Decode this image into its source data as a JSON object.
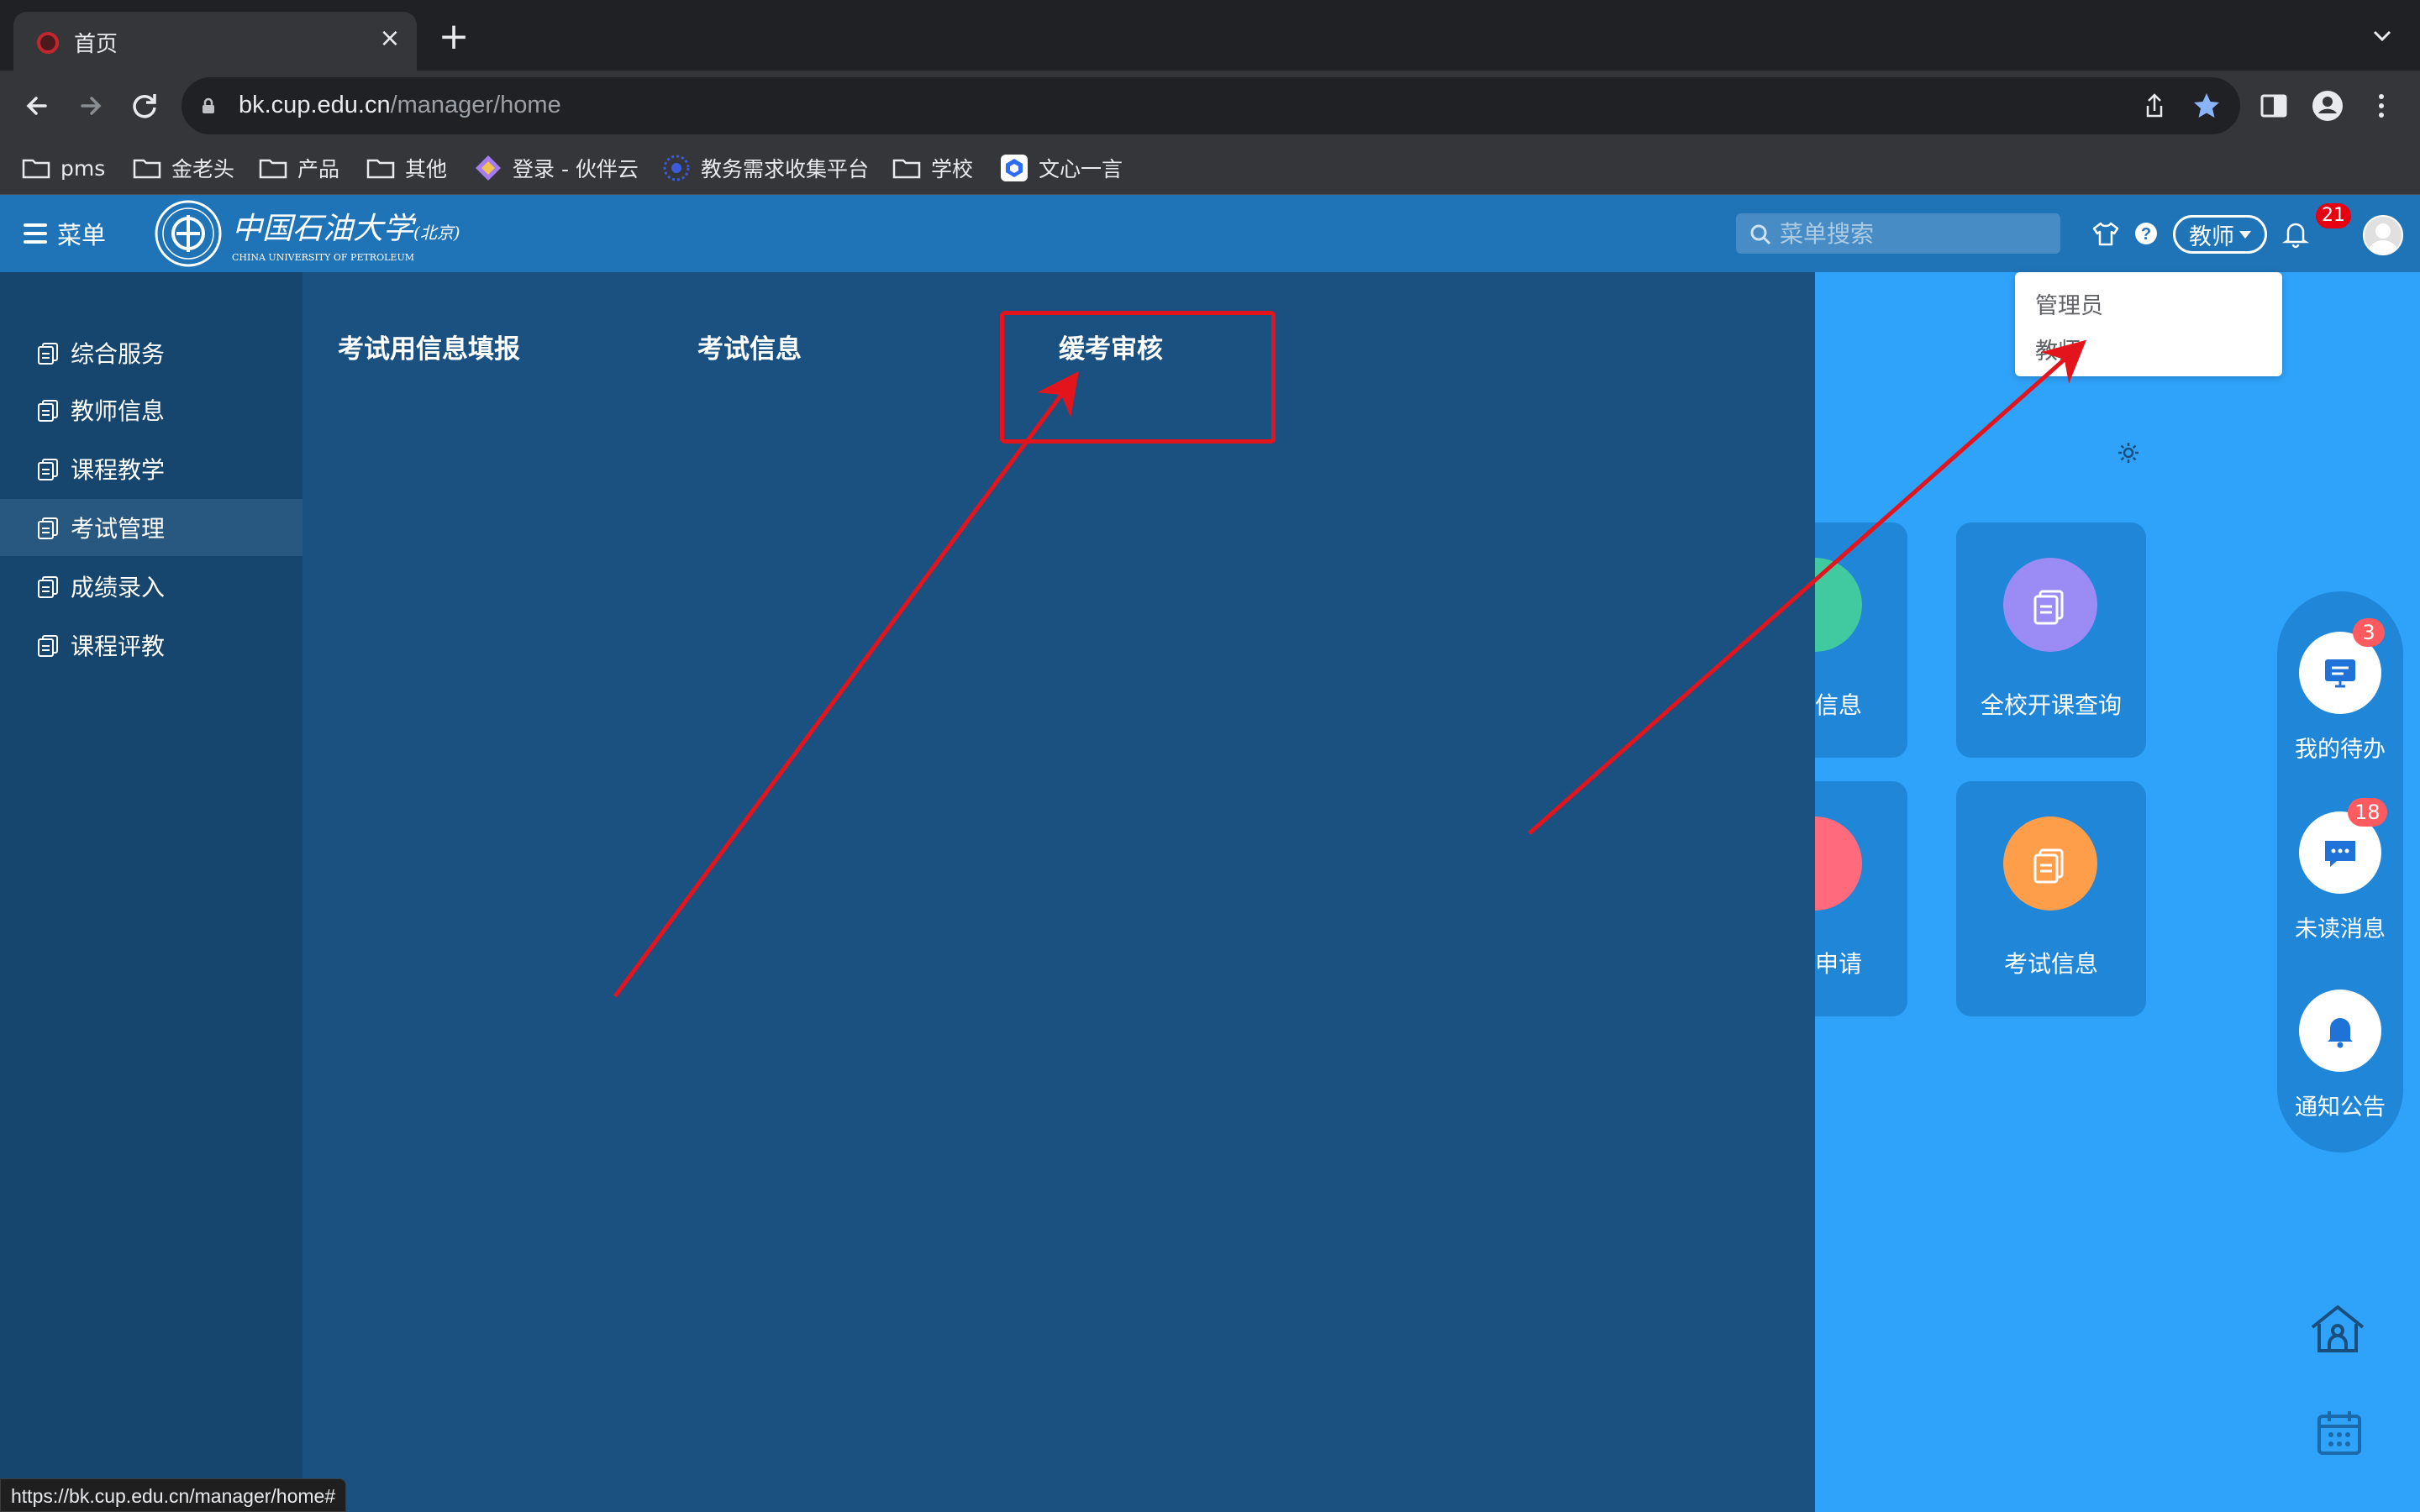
{
  "browser": {
    "tab_title": "首页",
    "tab_close": "×",
    "new_tab": "+",
    "url_host": "bk.cup.edu.cn",
    "url_path": "/manager/home",
    "bookmarks": [
      "pms",
      "金老头",
      "产品",
      "其他",
      "登录 - 伙伴云",
      "教务需求收集平台",
      "学校",
      "文心一言"
    ],
    "status_url": "https://bk.cup.edu.cn/manager/home#"
  },
  "header": {
    "menu_label": "菜单",
    "logo_text": "中国石油大学",
    "logo_sub": "(北京)",
    "logo_en": "CHINA UNIVERSITY OF PETROLEUM",
    "search_placeholder": "菜单搜索",
    "role_current": "教师",
    "notification_count": "21"
  },
  "role_dropdown": {
    "options": [
      "管理员",
      "教师"
    ]
  },
  "sidebar": {
    "items": [
      {
        "label": "综合服务"
      },
      {
        "label": "教师信息"
      },
      {
        "label": "课程教学"
      },
      {
        "label": "考试管理",
        "active": true
      },
      {
        "label": "成绩录入"
      },
      {
        "label": "课程评教"
      }
    ]
  },
  "mega_menu": {
    "items": [
      "考试用信息填报",
      "考试信息",
      "缓考审核"
    ]
  },
  "cards": {
    "partial_top_label": "信息",
    "partial_bottom_label": "申请",
    "items": [
      {
        "label": "全校开课查询",
        "color": "#9b8cf5"
      },
      {
        "label": "考试信息",
        "color": "#ff9e4a"
      }
    ]
  },
  "float_panel": {
    "items": [
      {
        "label": "我的待办",
        "badge": "3"
      },
      {
        "label": "未读消息",
        "badge": "18"
      },
      {
        "label": "通知公告"
      }
    ]
  },
  "colors": {
    "header_bg": "#1f73b7",
    "sidebar_bg": "#16466e",
    "mega_bg": "#1a5180",
    "content_bg": "#2fa2f9",
    "annotation": "#e3141b"
  }
}
